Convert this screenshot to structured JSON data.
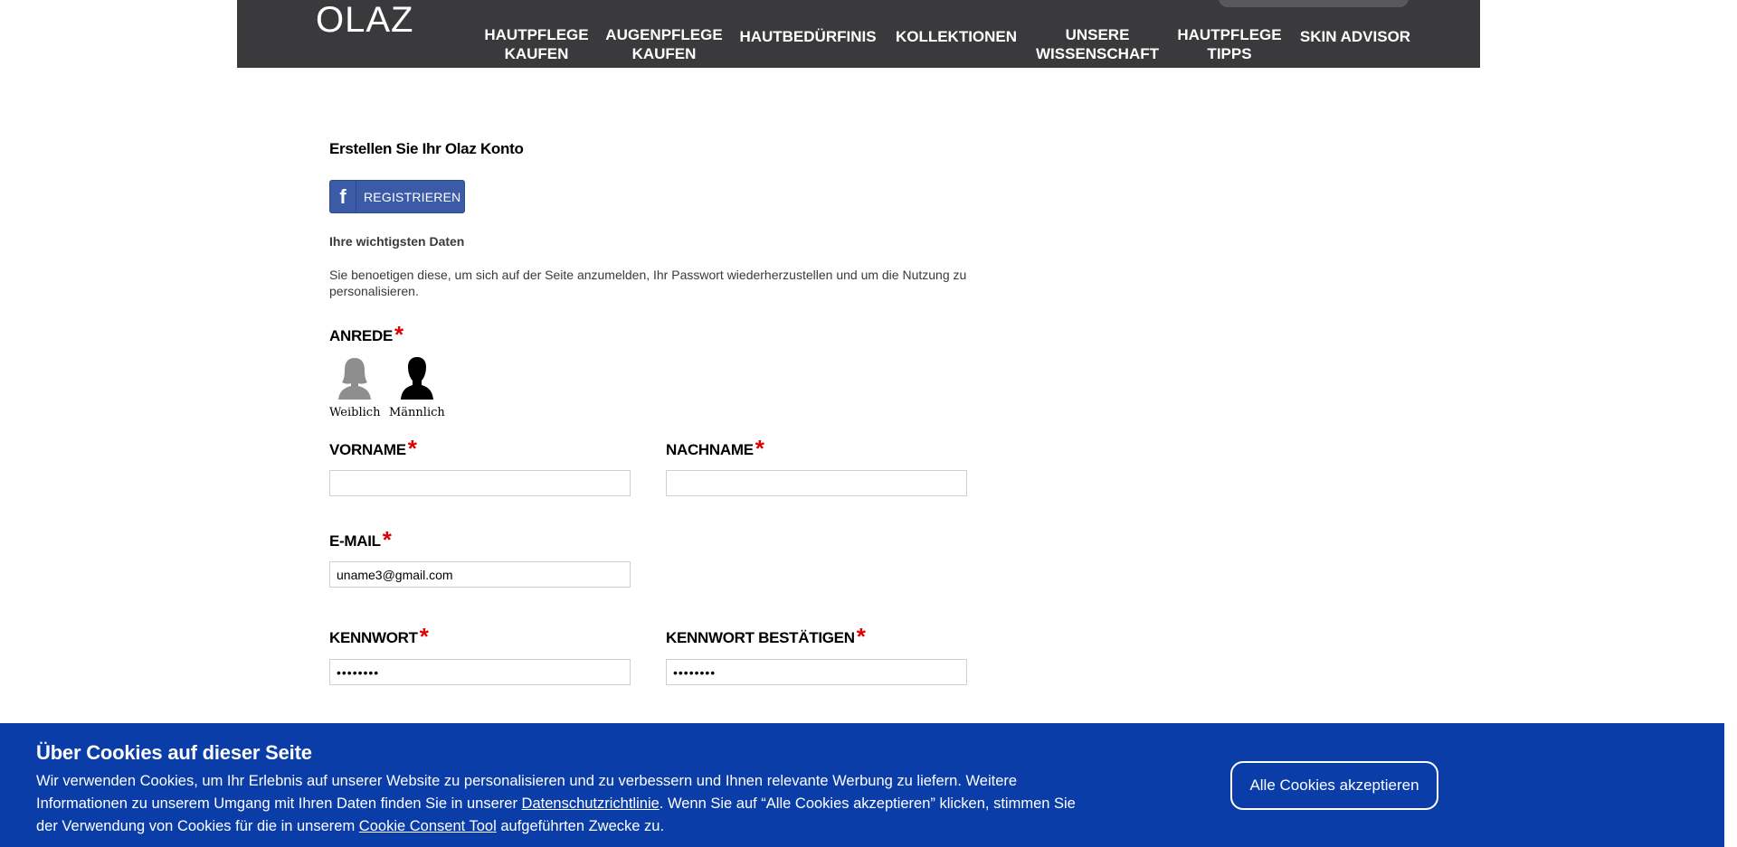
{
  "header": {
    "logo_text": "OLAZ",
    "nav": [
      {
        "label": "HAUTPFLEGE\nKAUFEN"
      },
      {
        "label": "AUGENPFLEGE\nKAUFEN"
      },
      {
        "label": "HAUTBEDÜRFINIS"
      },
      {
        "label": "KOLLEKTIONEN"
      },
      {
        "label": "UNSERE\nWISSENSCHAFT"
      },
      {
        "label": "HAUTPFLEGE\nTIPPS"
      },
      {
        "label": "SKIN ADVISOR"
      }
    ]
  },
  "form": {
    "title": "Erstellen Sie Ihr Olaz Konto",
    "facebook_button_label": "REGISTRIEREN",
    "section_title": "Ihre wichtigsten Daten",
    "section_description": "Sie benoetigen diese, um sich auf der Seite anzumelden, Ihr Passwort wiederherzustellen und um die Nutzung zu personalisieren.",
    "required_marker": "*",
    "salutation": {
      "label": "ANREDE",
      "options": [
        {
          "label": "Weiblich",
          "icon": "female-silhouette-icon"
        },
        {
          "label": "Männlich",
          "icon": "male-silhouette-icon"
        }
      ]
    },
    "first_name": {
      "label": "VORNAME",
      "value": ""
    },
    "last_name": {
      "label": "NACHNAME",
      "value": ""
    },
    "email": {
      "label": "E-MAIL",
      "value": "uname3@gmail.com"
    },
    "password": {
      "label": "KENNWORT",
      "value": "••••••••"
    },
    "password_confirm": {
      "label": "KENNWORT BESTÄTIGEN",
      "value": "••••••••"
    }
  },
  "cookie_banner": {
    "title": "Über Cookies auf dieser Seite",
    "text_part1": "Wir verwenden Cookies, um Ihr Erlebnis auf unserer Website zu personalisieren und zu verbessern und Ihnen relevante Werbung zu liefern. Weitere Informationen zu unserem Umgang mit Ihren Daten finden Sie in unserer ",
    "privacy_link": "Datenschutzrichtlinie",
    "text_part2": ". Wenn Sie auf “Alle Cookies akzeptieren” klicken, stimmen Sie der Verwendung von Cookies für die in unserem ",
    "consent_link": "Cookie Consent Tool",
    "text_part3": " aufgeführten Zwecke zu.",
    "accept_button": "Alle Cookies akzeptieren"
  },
  "colors": {
    "header_bg": "#3a3a3c",
    "facebook_blue": "#3b5ba7",
    "cookie_banner_bg": "#0a3da8",
    "required_red": "#e00000"
  }
}
